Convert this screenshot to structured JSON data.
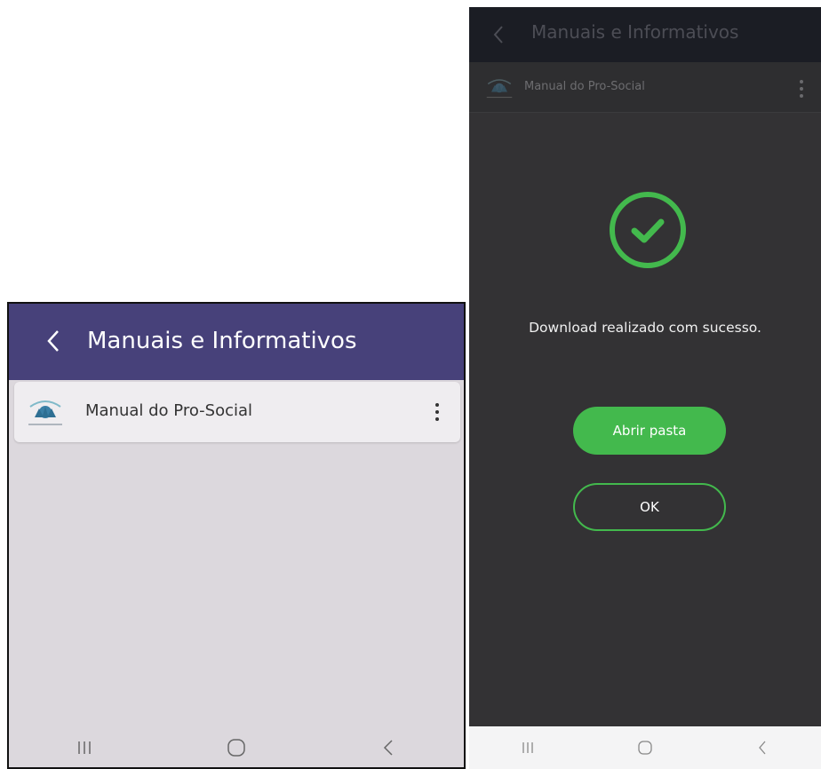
{
  "left_screen": {
    "app_title": "Manuais e Informativos",
    "item": {
      "label": "Manual do Pro-Social"
    }
  },
  "right_screen": {
    "app_title": "Manuais e Informativos",
    "item": {
      "label": "Manual do Pro-Social"
    },
    "dialog": {
      "message": "Download realizado com sucesso.",
      "primary_button": "Abrir pasta",
      "secondary_button": "OK"
    }
  },
  "colors": {
    "left_header": "#47417a",
    "left_background": "#dcd8dd",
    "right_background": "#333234",
    "right_header": "#1b1d24",
    "success_green": "#43b94d"
  },
  "icons": [
    "back-chevron-icon",
    "app-logo-icon",
    "more-vert-icon",
    "check-circle-icon",
    "recents-icon",
    "home-icon",
    "back-icon"
  ]
}
